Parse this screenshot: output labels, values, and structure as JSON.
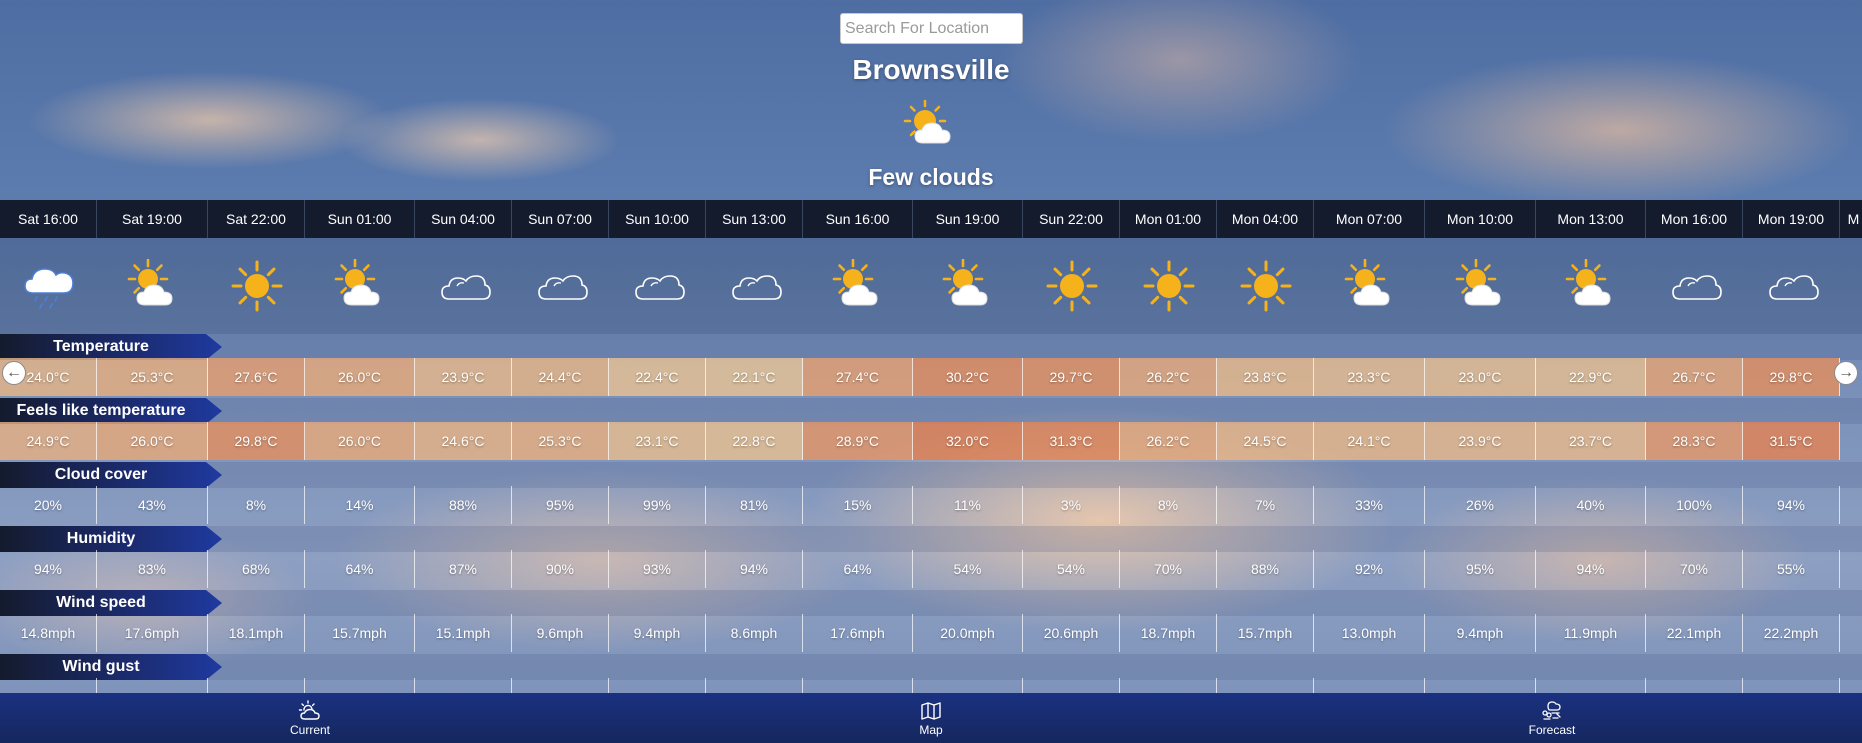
{
  "search": {
    "placeholder": "Search For Location"
  },
  "location": {
    "city": "Brownsville",
    "condition": "Few clouds",
    "condition_icon": "sun-cloud-icon"
  },
  "forecast": {
    "columns": [
      {
        "time": "Sat 16:00",
        "icon": "rain-cloud-icon",
        "temperature": "24.0°C",
        "feels_like": "24.9°C",
        "cloud_cover": "20%",
        "humidity": "94%",
        "wind_speed": "14.8mph"
      },
      {
        "time": "Sat 19:00",
        "icon": "sun-cloud-icon",
        "temperature": "25.3°C",
        "feels_like": "26.0°C",
        "cloud_cover": "43%",
        "humidity": "83%",
        "wind_speed": "17.6mph"
      },
      {
        "time": "Sat 22:00",
        "icon": "sun-icon",
        "temperature": "27.6°C",
        "feels_like": "29.8°C",
        "cloud_cover": "8%",
        "humidity": "68%",
        "wind_speed": "18.1mph"
      },
      {
        "time": "Sun 01:00",
        "icon": "sun-cloud-icon",
        "temperature": "26.0°C",
        "feels_like": "26.0°C",
        "cloud_cover": "14%",
        "humidity": "64%",
        "wind_speed": "15.7mph"
      },
      {
        "time": "Sun 04:00",
        "icon": "cloud-icon",
        "temperature": "23.9°C",
        "feels_like": "24.6°C",
        "cloud_cover": "88%",
        "humidity": "87%",
        "wind_speed": "15.1mph"
      },
      {
        "time": "Sun 07:00",
        "icon": "cloud-icon",
        "temperature": "24.4°C",
        "feels_like": "25.3°C",
        "cloud_cover": "95%",
        "humidity": "90%",
        "wind_speed": "9.6mph"
      },
      {
        "time": "Sun 10:00",
        "icon": "cloud-icon",
        "temperature": "22.4°C",
        "feels_like": "23.1°C",
        "cloud_cover": "99%",
        "humidity": "93%",
        "wind_speed": "9.4mph"
      },
      {
        "time": "Sun 13:00",
        "icon": "cloud-icon",
        "temperature": "22.1°C",
        "feels_like": "22.8°C",
        "cloud_cover": "81%",
        "humidity": "94%",
        "wind_speed": "8.6mph"
      },
      {
        "time": "Sun 16:00",
        "icon": "sun-cloud-icon",
        "temperature": "27.4°C",
        "feels_like": "28.9°C",
        "cloud_cover": "15%",
        "humidity": "64%",
        "wind_speed": "17.6mph"
      },
      {
        "time": "Sun 19:00",
        "icon": "sun-cloud-icon",
        "temperature": "30.2°C",
        "feels_like": "32.0°C",
        "cloud_cover": "11%",
        "humidity": "54%",
        "wind_speed": "20.0mph"
      },
      {
        "time": "Sun 22:00",
        "icon": "sun-icon",
        "temperature": "29.7°C",
        "feels_like": "31.3°C",
        "cloud_cover": "3%",
        "humidity": "54%",
        "wind_speed": "20.6mph"
      },
      {
        "time": "Mon 01:00",
        "icon": "sun-icon",
        "temperature": "26.2°C",
        "feels_like": "26.2°C",
        "cloud_cover": "8%",
        "humidity": "70%",
        "wind_speed": "18.7mph"
      },
      {
        "time": "Mon 04:00",
        "icon": "sun-icon",
        "temperature": "23.8°C",
        "feels_like": "24.5°C",
        "cloud_cover": "7%",
        "humidity": "88%",
        "wind_speed": "15.7mph"
      },
      {
        "time": "Mon 07:00",
        "icon": "sun-cloud-icon",
        "temperature": "23.3°C",
        "feels_like": "24.1°C",
        "cloud_cover": "33%",
        "humidity": "92%",
        "wind_speed": "13.0mph"
      },
      {
        "time": "Mon 10:00",
        "icon": "sun-cloud-icon",
        "temperature": "23.0°C",
        "feels_like": "23.9°C",
        "cloud_cover": "26%",
        "humidity": "95%",
        "wind_speed": "9.4mph"
      },
      {
        "time": "Mon 13:00",
        "icon": "sun-cloud-icon",
        "temperature": "22.9°C",
        "feels_like": "23.7°C",
        "cloud_cover": "40%",
        "humidity": "94%",
        "wind_speed": "11.9mph"
      },
      {
        "time": "Mon 16:00",
        "icon": "cloud-icon",
        "temperature": "26.7°C",
        "feels_like": "28.3°C",
        "cloud_cover": "100%",
        "humidity": "70%",
        "wind_speed": "22.1mph"
      },
      {
        "time": "Mon 19:00",
        "icon": "cloud-icon",
        "temperature": "29.8°C",
        "feels_like": "31.5°C",
        "cloud_cover": "94%",
        "humidity": "55%",
        "wind_speed": "22.2mph"
      },
      {
        "time": "M",
        "icon": "",
        "temperature": "",
        "feels_like": "",
        "cloud_cover": "",
        "humidity": "",
        "wind_speed": ""
      }
    ]
  },
  "labels": {
    "temperature": "Temperature",
    "feels_like": "Feels like temperature",
    "cloud_cover": "Cloud cover",
    "humidity": "Humidity",
    "wind_speed": "Wind speed",
    "wind_gust": "Wind gust"
  },
  "nav": {
    "current": {
      "label": "Current",
      "icon": "sun-cloud-outline-icon"
    },
    "map": {
      "label": "Map",
      "icon": "map-icon"
    },
    "forecast": {
      "label": "Forecast",
      "icon": "forecast-icon"
    }
  },
  "colors": {
    "time_bar": "#141b2d",
    "bottom_nav": "#1a3180",
    "label_tag": "#1f3aa0",
    "sun": "#f6b21b",
    "warm_cell": "#e9a06a"
  }
}
